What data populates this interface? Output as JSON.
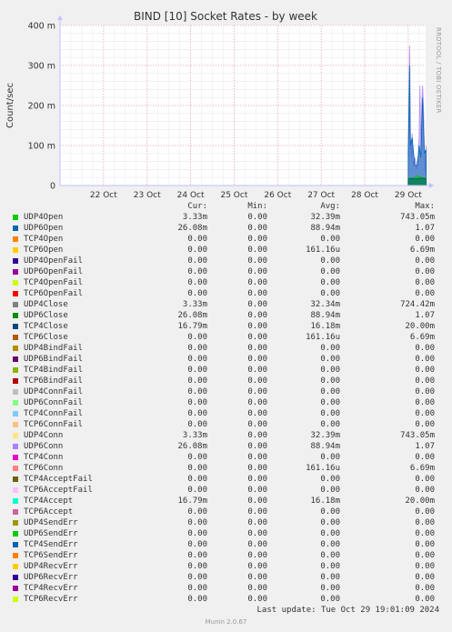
{
  "chart_data": {
    "type": "area",
    "title": "BIND [10] Socket Rates - by week",
    "ylabel": "Count/sec",
    "xlabel": "",
    "yticks": [
      "0",
      "100 m",
      "200 m",
      "300 m",
      "400 m"
    ],
    "ytick_values": [
      0,
      0.1,
      0.2,
      0.3,
      0.4
    ],
    "ylim": [
      0,
      0.4
    ],
    "xticks": [
      "22 Oct",
      "23 Oct",
      "24 Oct",
      "25 Oct",
      "26 Oct",
      "27 Oct",
      "28 Oct",
      "29 Oct"
    ],
    "grid": true,
    "series": [
      {
        "name": "UDP6Conn",
        "color": "#b38cf0",
        "x": [
          29.0,
          29.01,
          29.02,
          29.03,
          29.04,
          29.05,
          29.07,
          29.09,
          29.11,
          29.13,
          29.15,
          29.17,
          29.19,
          29.21,
          29.23,
          29.25,
          29.27,
          29.29,
          29.31,
          29.33,
          29.35,
          29.37,
          29.39,
          29.41
        ],
        "y": [
          0.09,
          0.07,
          0.15,
          0.35,
          0.28,
          0.12,
          0.07,
          0.13,
          0.06,
          0.05,
          0.07,
          0.06,
          0.04,
          0.06,
          0.07,
          0.12,
          0.25,
          0.08,
          0.2,
          0.25,
          0.2,
          0.1,
          0.03,
          0.1
        ]
      },
      {
        "name": "UDP6Open",
        "color": "#0066b3",
        "x": [
          29.0,
          29.03,
          29.05,
          29.09,
          29.15,
          29.21,
          29.25,
          29.29,
          29.33,
          29.37,
          29.41
        ],
        "y": [
          0.08,
          0.3,
          0.1,
          0.12,
          0.05,
          0.05,
          0.1,
          0.07,
          0.22,
          0.08,
          0.09
        ]
      },
      {
        "name": "UDP4Open",
        "color": "#00cc00",
        "x": [
          29.0,
          29.1,
          29.2,
          29.3,
          29.41
        ],
        "y": [
          0.02,
          0.015,
          0.025,
          0.02,
          0.018
        ]
      },
      {
        "name": "TCP4Close",
        "color": "#005f5f",
        "x": [
          29.0,
          29.1,
          29.2,
          29.3,
          29.41
        ],
        "y": [
          0.017,
          0.018,
          0.017,
          0.019,
          0.017
        ]
      }
    ],
    "legend": {
      "headers": [
        "Cur:",
        "Min:",
        "Avg:",
        "Max:"
      ],
      "rows": [
        {
          "name": "UDP4Open",
          "color": "#00cc00",
          "cur": "3.33m",
          "min": "0.00",
          "avg": "32.39m",
          "max": "743.05m"
        },
        {
          "name": "UDP6Open",
          "color": "#0066b3",
          "cur": "26.08m",
          "min": "0.00",
          "avg": "88.94m",
          "max": "1.07"
        },
        {
          "name": "TCP4Open",
          "color": "#ff8000",
          "cur": "0.00",
          "min": "0.00",
          "avg": "0.00",
          "max": "0.00"
        },
        {
          "name": "TCP6Open",
          "color": "#ffcc00",
          "cur": "0.00",
          "min": "0.00",
          "avg": "161.16u",
          "max": "6.69m"
        },
        {
          "name": "UDP4OpenFail",
          "color": "#330099",
          "cur": "0.00",
          "min": "0.00",
          "avg": "0.00",
          "max": "0.00"
        },
        {
          "name": "UDP6OpenFail",
          "color": "#990099",
          "cur": "0.00",
          "min": "0.00",
          "avg": "0.00",
          "max": "0.00"
        },
        {
          "name": "TCP4OpenFail",
          "color": "#ccff00",
          "cur": "0.00",
          "min": "0.00",
          "avg": "0.00",
          "max": "0.00"
        },
        {
          "name": "TCP6OpenFail",
          "color": "#ff0000",
          "cur": "0.00",
          "min": "0.00",
          "avg": "0.00",
          "max": "0.00"
        },
        {
          "name": "UDP4Close",
          "color": "#808080",
          "cur": "3.33m",
          "min": "0.00",
          "avg": "32.34m",
          "max": "724.42m"
        },
        {
          "name": "UDP6Close",
          "color": "#008f00",
          "cur": "26.08m",
          "min": "0.00",
          "avg": "88.94m",
          "max": "1.07"
        },
        {
          "name": "TCP4Close",
          "color": "#00487d",
          "cur": "16.79m",
          "min": "0.00",
          "avg": "16.18m",
          "max": "20.00m"
        },
        {
          "name": "TCP6Close",
          "color": "#b35a00",
          "cur": "0.00",
          "min": "0.00",
          "avg": "161.16u",
          "max": "6.69m"
        },
        {
          "name": "UDP4BindFail",
          "color": "#b38f00",
          "cur": "0.00",
          "min": "0.00",
          "avg": "0.00",
          "max": "0.00"
        },
        {
          "name": "UDP6BindFail",
          "color": "#6b006b",
          "cur": "0.00",
          "min": "0.00",
          "avg": "0.00",
          "max": "0.00"
        },
        {
          "name": "TCP4BindFail",
          "color": "#8fb300",
          "cur": "0.00",
          "min": "0.00",
          "avg": "0.00",
          "max": "0.00"
        },
        {
          "name": "TCP6BindFail",
          "color": "#b30000",
          "cur": "0.00",
          "min": "0.00",
          "avg": "0.00",
          "max": "0.00"
        },
        {
          "name": "UDP4ConnFail",
          "color": "#bebebe",
          "cur": "0.00",
          "min": "0.00",
          "avg": "0.00",
          "max": "0.00"
        },
        {
          "name": "UDP6ConnFail",
          "color": "#80ff80",
          "cur": "0.00",
          "min": "0.00",
          "avg": "0.00",
          "max": "0.00"
        },
        {
          "name": "TCP4ConnFail",
          "color": "#80c9ff",
          "cur": "0.00",
          "min": "0.00",
          "avg": "0.00",
          "max": "0.00"
        },
        {
          "name": "TCP6ConnFail",
          "color": "#ffc080",
          "cur": "0.00",
          "min": "0.00",
          "avg": "0.00",
          "max": "0.00"
        },
        {
          "name": "UDP4Conn",
          "color": "#ffe680",
          "cur": "3.33m",
          "min": "0.00",
          "avg": "32.39m",
          "max": "743.05m"
        },
        {
          "name": "UDP6Conn",
          "color": "#aa80ff",
          "cur": "26.08m",
          "min": "0.00",
          "avg": "88.94m",
          "max": "1.07"
        },
        {
          "name": "TCP4Conn",
          "color": "#ee00cc",
          "cur": "0.00",
          "min": "0.00",
          "avg": "0.00",
          "max": "0.00"
        },
        {
          "name": "TCP6Conn",
          "color": "#ff8080",
          "cur": "0.00",
          "min": "0.00",
          "avg": "161.16u",
          "max": "6.69m"
        },
        {
          "name": "TCP4AcceptFail",
          "color": "#666600",
          "cur": "0.00",
          "min": "0.00",
          "avg": "0.00",
          "max": "0.00"
        },
        {
          "name": "TCP6AcceptFail",
          "color": "#ffbfff",
          "cur": "0.00",
          "min": "0.00",
          "avg": "0.00",
          "max": "0.00"
        },
        {
          "name": "TCP4Accept",
          "color": "#00ffcc",
          "cur": "16.79m",
          "min": "0.00",
          "avg": "16.18m",
          "max": "20.00m"
        },
        {
          "name": "TCP6Accept",
          "color": "#cc6699",
          "cur": "0.00",
          "min": "0.00",
          "avg": "0.00",
          "max": "0.00"
        },
        {
          "name": "UDP4SendErr",
          "color": "#999900",
          "cur": "0.00",
          "min": "0.00",
          "avg": "0.00",
          "max": "0.00"
        },
        {
          "name": "UDP6SendErr",
          "color": "#00cc00",
          "cur": "0.00",
          "min": "0.00",
          "avg": "0.00",
          "max": "0.00"
        },
        {
          "name": "TCP4SendErr",
          "color": "#0066b3",
          "cur": "0.00",
          "min": "0.00",
          "avg": "0.00",
          "max": "0.00"
        },
        {
          "name": "TCP6SendErr",
          "color": "#ff8000",
          "cur": "0.00",
          "min": "0.00",
          "avg": "0.00",
          "max": "0.00"
        },
        {
          "name": "UDP4RecvErr",
          "color": "#ffcc00",
          "cur": "0.00",
          "min": "0.00",
          "avg": "0.00",
          "max": "0.00"
        },
        {
          "name": "UDP6RecvErr",
          "color": "#330099",
          "cur": "0.00",
          "min": "0.00",
          "avg": "0.00",
          "max": "0.00"
        },
        {
          "name": "TCP4RecvErr",
          "color": "#990099",
          "cur": "0.00",
          "min": "0.00",
          "avg": "0.00",
          "max": "0.00"
        },
        {
          "name": "TCP6RecvErr",
          "color": "#ccff00",
          "cur": "0.00",
          "min": "0.00",
          "avg": "0.00",
          "max": "0.00"
        }
      ]
    }
  },
  "footer": {
    "last_update": "Last update: Tue Oct 29 19:01:09 2024",
    "version": "Munin 2.0.67",
    "side_label": "RRDTOOL / TOBI OETIKER"
  }
}
